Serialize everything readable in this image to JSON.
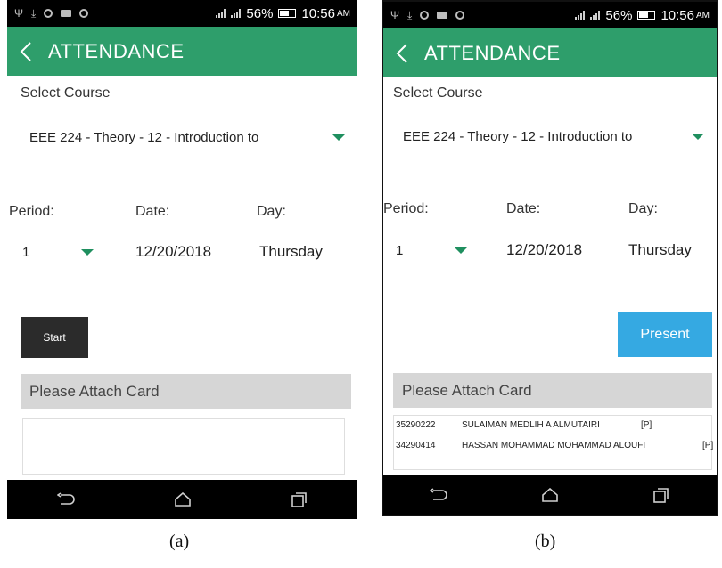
{
  "panels": [
    {
      "status": {
        "battery": "56%",
        "time": "10:56",
        "ampm": "AM"
      },
      "appbar": {
        "title": "ATTENDANCE",
        "back_icon": "chevron-left-icon"
      },
      "select_course_label": "Select Course",
      "course_value": "EEE 224 - Theory - 12 - Introduction to",
      "labels": {
        "period": "Period:",
        "date": "Date:",
        "day": "Day:"
      },
      "values": {
        "period": "1",
        "date": "12/20/2018",
        "day": "Thursday"
      },
      "action_button": "Start",
      "card_banner": "Please Attach Card",
      "records": [],
      "caption": "(a)"
    },
    {
      "status": {
        "battery": "56%",
        "time": "10:56",
        "ampm": "AM"
      },
      "appbar": {
        "title": "ATTENDANCE",
        "back_icon": "chevron-left-icon"
      },
      "select_course_label": "Select Course",
      "course_value": "EEE 224 - Theory - 12 - Introduction to",
      "labels": {
        "period": "Period:",
        "date": "Date:",
        "day": "Day:"
      },
      "values": {
        "period": "1",
        "date": "12/20/2018",
        "day": "Thursday"
      },
      "action_button": "Present",
      "card_banner": "Please Attach Card",
      "records": [
        {
          "id": "35290222",
          "name": "SULAIMAN MEDLIH A ALMUTAIRI",
          "status": "[P]"
        },
        {
          "id": "34290414",
          "name": "HASSAN MOHAMMAD MOHAMMAD ALOUFI",
          "status": "[P]"
        }
      ],
      "caption": "(b)"
    }
  ],
  "colors": {
    "appbar": "#2e9e6b",
    "caret": "#1f8f5f",
    "present_button": "#35a9e2",
    "start_button": "#2b2b2b",
    "banner": "#d6d6d6"
  }
}
